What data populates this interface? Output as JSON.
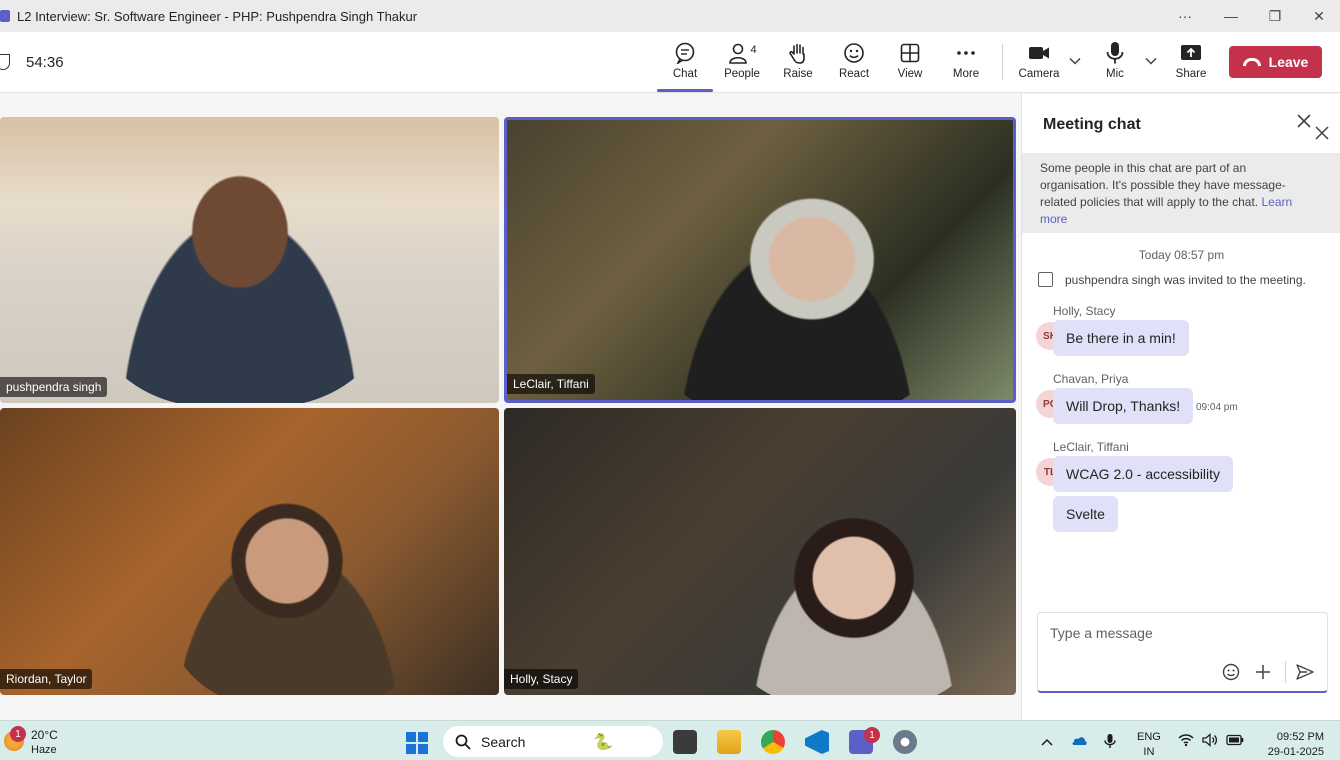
{
  "window": {
    "title": "L2 Interview: Sr. Software Engineer - PHP: Pushpendra Singh Thakur",
    "controls": {
      "more": "···",
      "minimize": "—",
      "restore": "❐",
      "close": "✕"
    }
  },
  "toolbar": {
    "timer": "54:36",
    "chat": "Chat",
    "people": "People",
    "people_count": "4",
    "raise": "Raise",
    "react": "React",
    "view": "View",
    "more": "More",
    "camera": "Camera",
    "mic": "Mic",
    "share": "Share",
    "leave": "Leave",
    "accent_color": "#5b5fc7",
    "leave_color": "#c4314b"
  },
  "participants": [
    {
      "name": "pushpendra singh"
    },
    {
      "name": "LeClair, Tiffani",
      "active_speaker": true
    },
    {
      "name": "Riordan, Taylor"
    },
    {
      "name": "Holly, Stacy"
    }
  ],
  "chat": {
    "title": "Meeting chat",
    "notice": "Some people in this chat are part of an organisation. It's possible they have message-related policies that will apply to the chat.",
    "notice_link": "Learn more",
    "timestamp": "Today 08:57 pm",
    "system_message": "pushpendra singh was invited to the meeting.",
    "messages": [
      {
        "sender": "Holly, Stacy",
        "initials": "SH",
        "text": "Be there in a min!"
      },
      {
        "sender": "Chavan, Priya",
        "initials": "PC",
        "text": "Will Drop, Thanks!",
        "time": "09:04 pm"
      },
      {
        "sender": "LeClair, Tiffani",
        "initials": "TL",
        "text": "WCAG 2.0 - accessibility"
      },
      {
        "sender": "",
        "initials": "",
        "text": "Svelte"
      }
    ],
    "compose_placeholder": "Type a message"
  },
  "taskbar": {
    "weather_badge": "1",
    "temperature": "20°C",
    "condition": "Haze",
    "search_label": "Search",
    "teams_badge": "1",
    "lang_top": "ENG",
    "lang_bottom": "IN",
    "time": "09:52 PM",
    "date": "29-01-2025"
  }
}
